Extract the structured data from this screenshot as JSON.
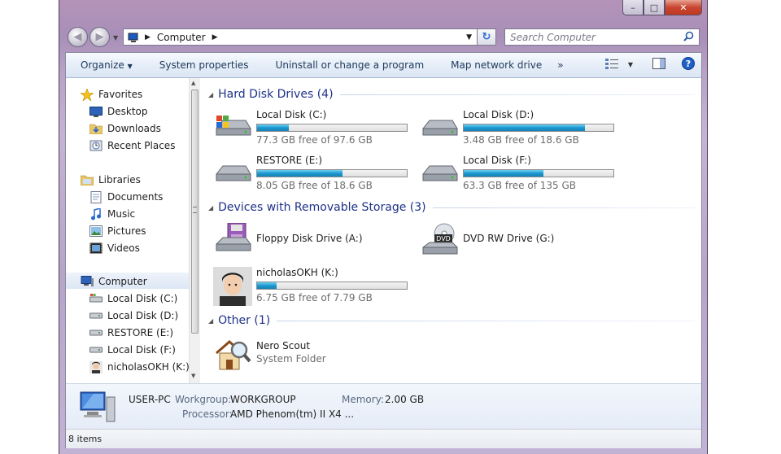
{
  "window": {
    "minimize": "–",
    "maximize": "□",
    "close": "✕"
  },
  "address": {
    "path": "Computer",
    "search_placeholder": "Search Computer"
  },
  "toolbar": {
    "organize": "Organize",
    "system_properties": "System properties",
    "uninstall": "Uninstall or change a program",
    "map_network": "Map network drive",
    "more": "»"
  },
  "nav": {
    "favorites": "Favorites",
    "desktop": "Desktop",
    "downloads": "Downloads",
    "recent": "Recent Places",
    "libraries": "Libraries",
    "documents": "Documents",
    "music": "Music",
    "pictures": "Pictures",
    "videos": "Videos",
    "computer": "Computer",
    "drives": [
      "Local Disk (C:)",
      "Local Disk (D:)",
      "RESTORE (E:)",
      "Local Disk (F:)",
      "nicholasOKH (K:)"
    ]
  },
  "groups": {
    "hdd": "Hard Disk Drives (4)",
    "removable": "Devices with Removable Storage (3)",
    "other": "Other (1)"
  },
  "hdd": [
    {
      "name": "Local Disk (C:)",
      "free": "77.3 GB free of 97.6 GB",
      "used_fraction": 0.21
    },
    {
      "name": "Local Disk (D:)",
      "free": "3.48 GB free of 18.6 GB",
      "used_fraction": 0.81
    },
    {
      "name": "RESTORE (E:)",
      "free": "8.05 GB free of 18.6 GB",
      "used_fraction": 0.57
    },
    {
      "name": "Local Disk (F:)",
      "free": "63.3 GB free of 135 GB",
      "used_fraction": 0.53
    }
  ],
  "removable": [
    {
      "name": "Floppy Disk Drive (A:)"
    },
    {
      "name": "DVD RW Drive (G:)",
      "badge": "DVD"
    },
    {
      "name": "nicholasOKH (K:)",
      "free": "6.75 GB free of 7.79 GB",
      "used_fraction": 0.13
    }
  ],
  "other": [
    {
      "name": "Nero Scout",
      "type": "System Folder"
    }
  ],
  "details": {
    "pc_name": "USER-PC",
    "workgroup_label": "Workgroup:",
    "workgroup": "WORKGROUP",
    "memory_label": "Memory:",
    "memory": "2.00 GB",
    "processor_label": "Processor:",
    "processor": "AMD Phenom(tm) II X4 ..."
  },
  "status": {
    "items": "8 items"
  },
  "colors": {
    "accent": "#1c98cf",
    "group_heading": "#1e3287"
  }
}
